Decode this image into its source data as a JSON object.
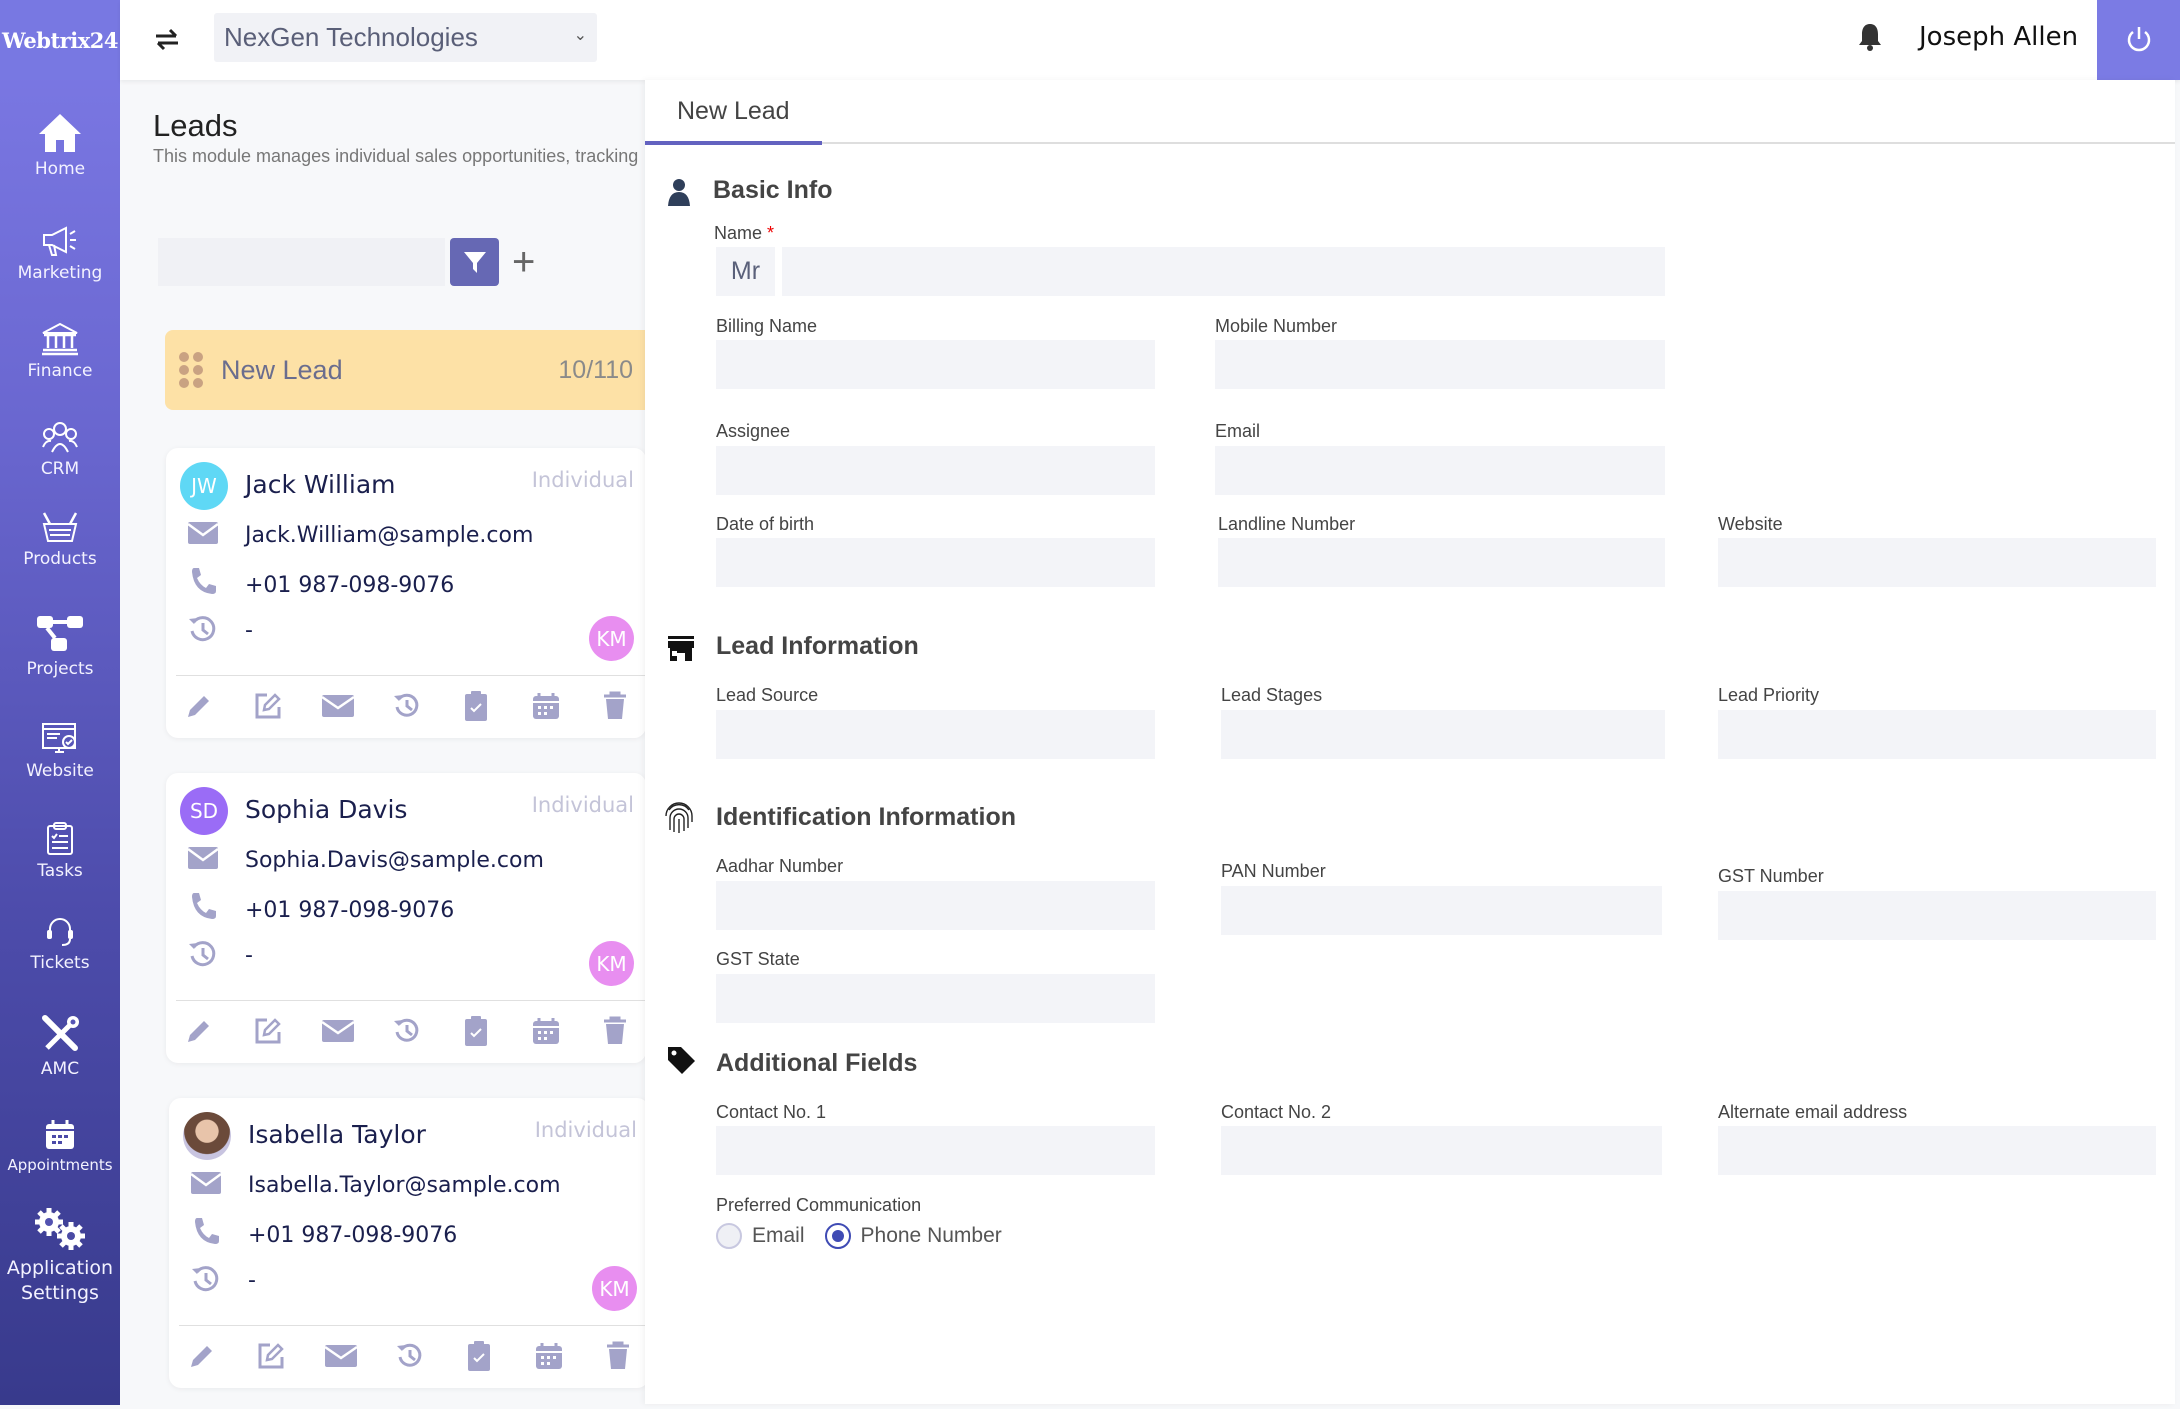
{
  "app": {
    "logo": "Webtrix24"
  },
  "sidebar": {
    "items": [
      {
        "label": "Home",
        "icon": "home-icon"
      },
      {
        "label": "Marketing",
        "icon": "megaphone-icon"
      },
      {
        "label": "Finance",
        "icon": "bank-icon"
      },
      {
        "label": "CRM",
        "icon": "people-icon"
      },
      {
        "label": "Products",
        "icon": "basket-icon"
      },
      {
        "label": "Projects",
        "icon": "project-icon"
      },
      {
        "label": "Website",
        "icon": "website-icon"
      },
      {
        "label": "Tasks",
        "icon": "clipboard-icon"
      },
      {
        "label": "Tickets",
        "icon": "headset-icon"
      },
      {
        "label": "AMC",
        "icon": "tools-icon"
      },
      {
        "label": "Appointments",
        "icon": "calendar-icon"
      },
      {
        "label": "Application Settings",
        "icon": "gears-icon"
      }
    ]
  },
  "header": {
    "company": "NexGen Technologies",
    "user_name": "Joseph Allen"
  },
  "leads": {
    "title": "Leads",
    "description": "This module manages individual sales opportunities, tracking",
    "search_placeholder": "",
    "stage": {
      "name": "New Lead",
      "count": "10/110"
    },
    "cards": [
      {
        "initials": "JW",
        "avatar_color": "#5fd8f5",
        "name": "Jack William",
        "type": "Individual",
        "email": "Jack.William@sample.com",
        "phone": "+01 987-098-9076",
        "last_activity": "-",
        "assignee": "KM"
      },
      {
        "initials": "SD",
        "avatar_color": "#9a6cf6",
        "name": "Sophia Davis",
        "type": "Individual",
        "email": "Sophia.Davis@sample.com",
        "phone": "+01 987-098-9076",
        "last_activity": "-",
        "assignee": "KM"
      },
      {
        "initials": "",
        "avatar_color": "#6b4a3a",
        "name": "Isabella Taylor",
        "type": "Individual",
        "email": "Isabella.Taylor@sample.com",
        "phone": "+01 987-098-9076",
        "last_activity": "-",
        "assignee": "KM"
      }
    ]
  },
  "form": {
    "tab": "New Lead",
    "sections": {
      "basic": "Basic Info",
      "lead": "Lead Information",
      "ident": "Identification Information",
      "additional": "Additional Fields"
    },
    "fields": {
      "name": {
        "label": "Name",
        "required_mark": "*",
        "prefix": "Mr",
        "value": ""
      },
      "billing_name": {
        "label": "Billing Name",
        "value": ""
      },
      "mobile_number": {
        "label": "Mobile Number",
        "value": ""
      },
      "assignee": {
        "label": "Assignee",
        "value": ""
      },
      "email": {
        "label": "Email",
        "value": ""
      },
      "dob": {
        "label": "Date of birth",
        "value": ""
      },
      "landline": {
        "label": "Landline Number",
        "value": ""
      },
      "website": {
        "label": "Website",
        "value": ""
      },
      "lead_source": {
        "label": "Lead Source",
        "value": ""
      },
      "lead_stages": {
        "label": "Lead Stages",
        "value": ""
      },
      "lead_priority": {
        "label": "Lead Priority",
        "value": ""
      },
      "aadhar": {
        "label": "Aadhar Number",
        "value": ""
      },
      "pan": {
        "label": "PAN Number",
        "value": ""
      },
      "gst_number": {
        "label": "GST Number",
        "value": ""
      },
      "gst_state": {
        "label": "GST State",
        "value": ""
      },
      "contact1": {
        "label": "Contact No. 1",
        "value": ""
      },
      "contact2": {
        "label": "Contact No. 2",
        "value": ""
      },
      "alt_email": {
        "label": "Alternate email address",
        "value": ""
      }
    },
    "preferred_communication": {
      "label": "Preferred Communication",
      "options": [
        "Email",
        "Phone Number"
      ],
      "selected": "Phone Number"
    }
  },
  "colors": {
    "accent": "#6362c0",
    "sidebar_top": "#7d7ae6",
    "sidebar_bottom": "#383a8c",
    "stage_bg": "#fde1a6",
    "icon_muted": "#a3a3c9"
  }
}
